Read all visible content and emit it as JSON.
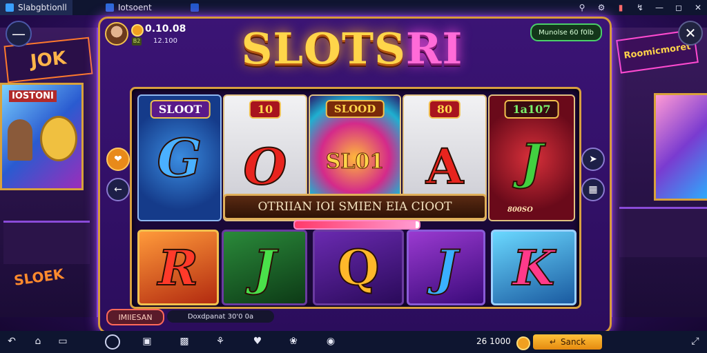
{
  "window": {
    "tabs": [
      {
        "label": "Slabgbtionll"
      },
      {
        "label": "Iotsoent"
      },
      {
        "label": ""
      }
    ]
  },
  "header": {
    "balance_main": "0.10.08",
    "balance_sub": "12.100",
    "badge_small": "B2",
    "top_right_badge": "Munolse 60 f0lb",
    "logo_part1": "SLOTS",
    "logo_part2": "RI"
  },
  "reels": {
    "top": [
      {
        "symbol": "G",
        "caption": "SLOOT"
      },
      {
        "symbol": "O",
        "caption": "10"
      },
      {
        "symbol": "$",
        "caption": "SLOOD"
      },
      {
        "symbol": "A",
        "caption": "80"
      },
      {
        "symbol": "J",
        "caption": "1a107"
      }
    ],
    "center_symbol_text": "SL01",
    "tile5_sub": "800SO",
    "banner_text": "OTRIIAN IOI SMIEN EIA CIOOT",
    "progress_fraction": 0.97,
    "bottom": [
      {
        "symbol": "R"
      },
      {
        "symbol": "J"
      },
      {
        "symbol": "Q"
      },
      {
        "symbol": "J"
      },
      {
        "symbol": "K"
      }
    ]
  },
  "footer_machine": {
    "pill_left": "IMIIESAN",
    "pill_right": "Doxdpanat 30'0 0a"
  },
  "cabinets": {
    "left_sign": "JOK",
    "left_screen_text": "IOSTONI",
    "left_bottom": "SLOEK",
    "right_sign": "Roomicmoret"
  },
  "bottombar": {
    "balance": "26 1000",
    "back_label": "Sanck"
  },
  "colors": {
    "accent_gold": "#f2c14e",
    "accent_purple": "#5a22a8",
    "back_button": "#ffc23a"
  }
}
